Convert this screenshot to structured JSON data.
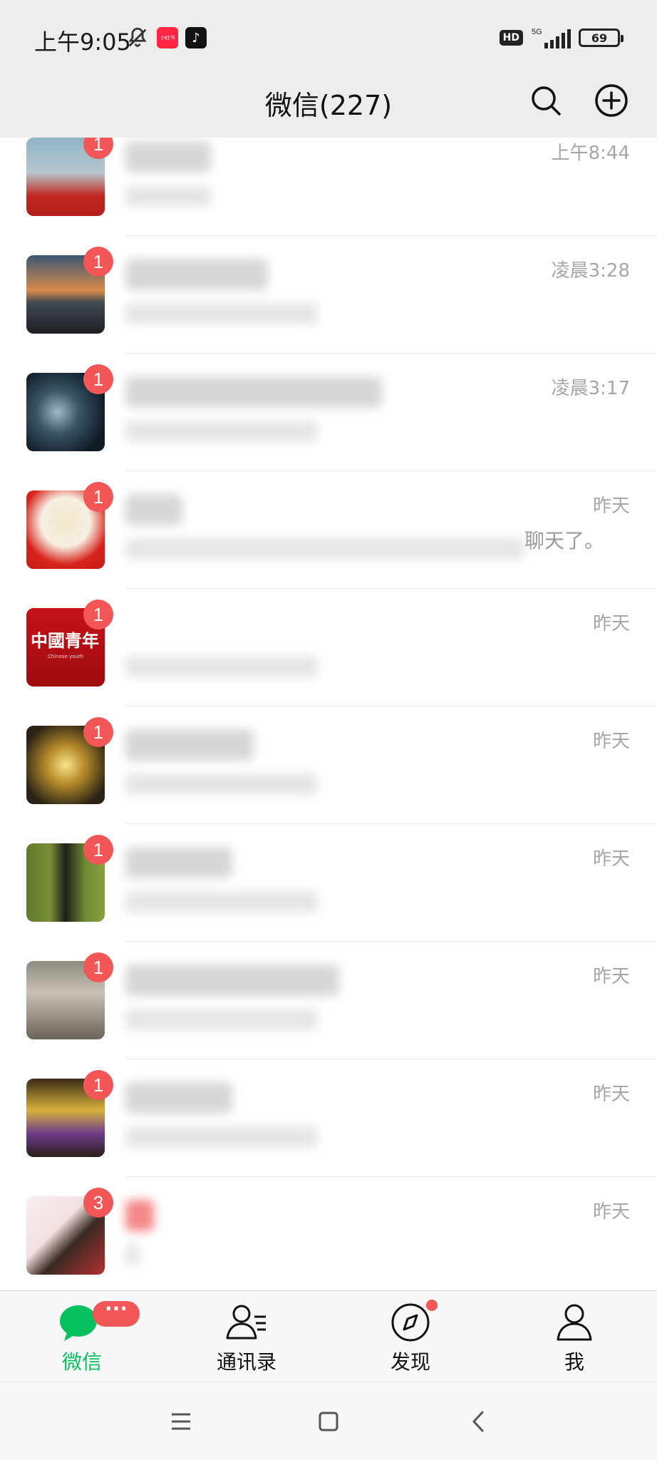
{
  "status_bar": {
    "time": "上午9:05",
    "app_icon_1": "小红书",
    "network": "5G",
    "battery": "69"
  },
  "header": {
    "title": "微信(227)"
  },
  "chats": [
    {
      "time": "上午8:44",
      "unread": "1",
      "preview_text": ""
    },
    {
      "time": "凌晨3:28",
      "unread": "1",
      "preview_text": ""
    },
    {
      "time": "凌晨3:17",
      "unread": "1",
      "preview_text": ""
    },
    {
      "time": "昨天",
      "unread": "1",
      "preview_text": "聊天了。"
    },
    {
      "time": "昨天",
      "unread": "1",
      "preview_text": "",
      "avatar_text": "中國青年",
      "avatar_sub": "Chinese youth"
    },
    {
      "time": "昨天",
      "unread": "1",
      "preview_text": ""
    },
    {
      "time": "昨天",
      "unread": "1",
      "preview_text": ""
    },
    {
      "time": "昨天",
      "unread": "1",
      "preview_text": ""
    },
    {
      "time": "昨天",
      "unread": "1",
      "preview_text": ""
    },
    {
      "time": "昨天",
      "unread": "3",
      "preview_text": ""
    }
  ],
  "tabs": {
    "chats": "微信",
    "contacts": "通讯录",
    "discover": "发现",
    "me": "我",
    "more": "···"
  },
  "colors": {
    "accent": "#07c160",
    "badge": "#f25656"
  }
}
